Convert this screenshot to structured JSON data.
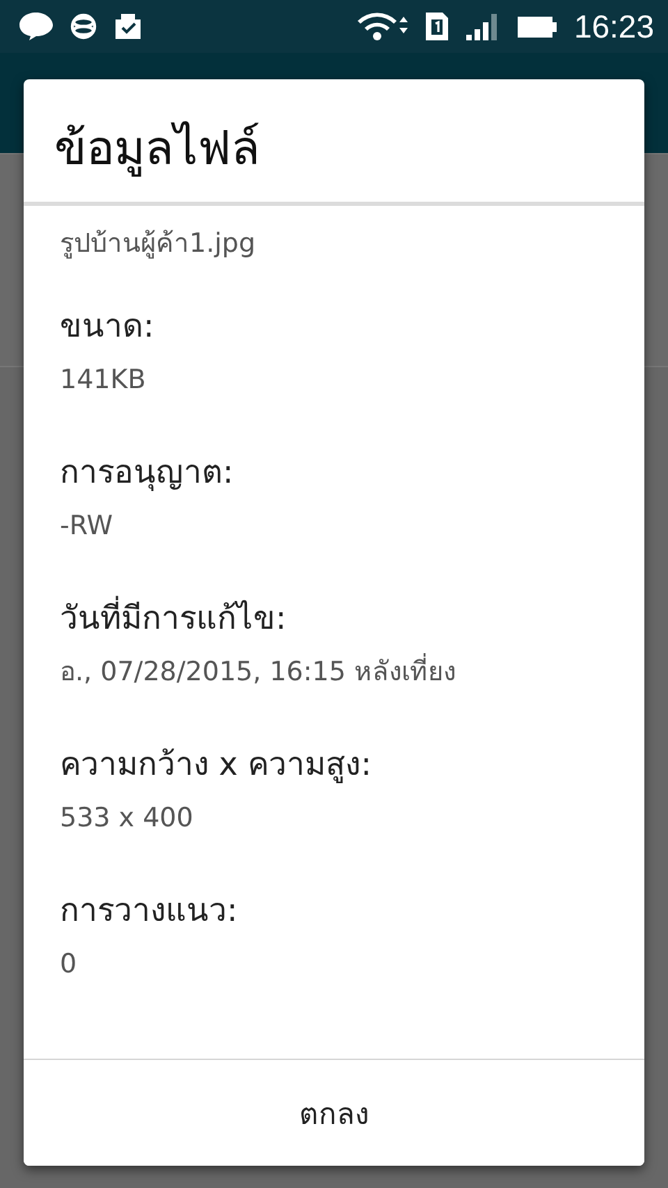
{
  "status_bar": {
    "time": "16:23"
  },
  "dialog": {
    "title": "ข้อมูลไฟล์",
    "file_name": "รูปบ้านผู้ค้า1.jpg",
    "fields": [
      {
        "label": "ขนาด:",
        "value": "141KB"
      },
      {
        "label": "การอนุญาต:",
        "value": "-RW"
      },
      {
        "label": "วันที่มีการแก้ไข:",
        "value": "อ., 07/28/2015, 16:15 หลังเที่ยง"
      },
      {
        "label": "ความกว้าง x ความสูง:",
        "value": "533 x 400"
      },
      {
        "label": "การวางแนว:",
        "value": "0"
      }
    ],
    "buttons": [
      "ตกลง"
    ]
  }
}
